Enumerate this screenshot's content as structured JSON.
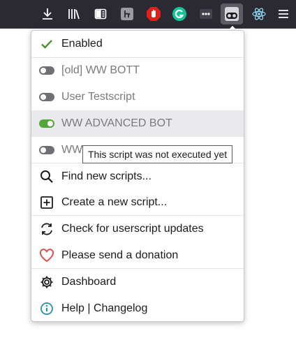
{
  "toolbar": {
    "icons": [
      "download-icon",
      "library-icon",
      "reader-view-icon",
      "extension-h-icon",
      "ublock-icon",
      "grammarly-icon",
      "more-dots-icon",
      "userscript-manager-icon",
      "react-devtools-icon",
      "hamburger-menu-icon"
    ]
  },
  "menu": {
    "enabled_label": "Enabled",
    "scripts": [
      {
        "label": "[old] WW BOTT",
        "enabled": false
      },
      {
        "label": "User Testscript",
        "enabled": false
      },
      {
        "label": "WW ADVANCED BOT",
        "enabled": true
      },
      {
        "label": "WW",
        "enabled": false
      }
    ],
    "find_scripts": "Find new scripts...",
    "create_script": "Create a new script...",
    "check_updates": "Check for userscript updates",
    "donation": "Please send a donation",
    "dashboard": "Dashboard",
    "help": "Help | Changelog"
  },
  "tooltip": "This script was not executed yet",
  "colors": {
    "toolbar_bg": "#2b2a33",
    "check_green": "#3d8a25",
    "toggle_on": "#55a63a",
    "heart_red": "#d9534f",
    "info_teal": "#2a8fa8"
  }
}
